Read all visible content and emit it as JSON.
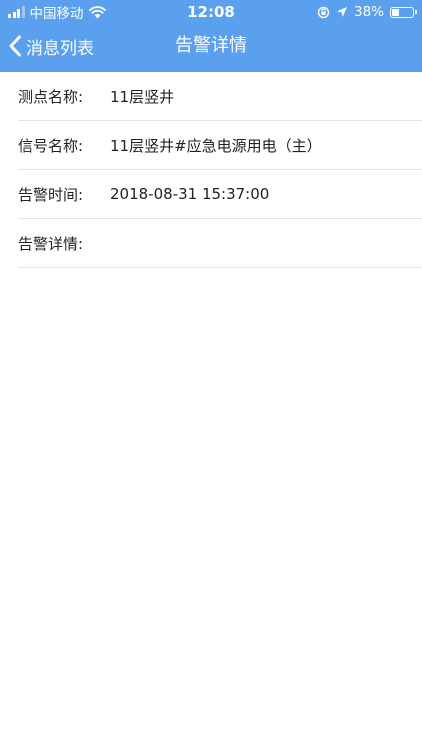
{
  "status_bar": {
    "carrier": "中国移动",
    "time": "12:08",
    "battery_text": "38%",
    "battery_level": 0.38
  },
  "nav": {
    "back_label": "消息列表",
    "title": "告警详情"
  },
  "details": [
    {
      "label": "测点名称:",
      "value": "11层竖井"
    },
    {
      "label": "信号名称:",
      "value": "11层竖井#应急电源用电（主）"
    },
    {
      "label": "告警时间:",
      "value": "2018-08-31 15:37:00"
    },
    {
      "label": "告警详情:",
      "value": ""
    }
  ],
  "colors": {
    "header_bg": "#5aa0ee",
    "divider": "#e4e4e4",
    "text": "#222222"
  }
}
